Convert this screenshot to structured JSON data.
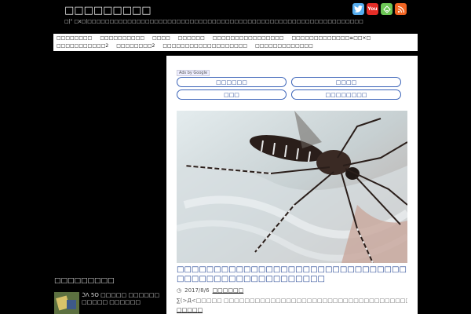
{
  "header": {
    "site_title": "□□□□□□□□□",
    "site_description": "□|\" □x□|□□□□□□□□□□□□□□□□□□□□□□□□□□□□□□□□□□□□□□□□□□□□□□□□□□□□□□□□□□□□□□",
    "social": [
      {
        "name": "twitter",
        "glyph": "t",
        "color": "#55acee"
      },
      {
        "name": "youtube",
        "glyph": "You",
        "color": "#e52d27"
      },
      {
        "name": "feedly",
        "glyph": "f",
        "color": "#6cc655"
      },
      {
        "name": "rss",
        "glyph": "rss",
        "color": "#f26522"
      }
    ]
  },
  "nav": {
    "items": [
      "□□□□□□□□",
      "□□□□□□□□□□",
      "□□□□",
      "□□□□□□",
      "□□□□□□□□□□□□□□□□",
      "□□□□□□□□□□□□□≡□□×□",
      "□□□□□□□□□□□2",
      "□□□□□□□□2",
      "□□□□□□□□□□□□□□□□□□□",
      "□□□□□□□□□□□□□"
    ]
  },
  "ads": {
    "label": "Ads by Google",
    "links": [
      "□□□□□□",
      "□□□□",
      "□□□",
      "□□□□□□□□"
    ]
  },
  "post": {
    "title": "□□□□□□□□□□□□□□□□□□□□□□□□□□□□□□□□□□□□□□□□□□□□□□□□□□□",
    "date": "2017/8/6",
    "category": "□□□□□□",
    "excerpt": "∑(>Д<□□□□□ □□□□□□□□□□□□□□□□□□□□□□□□□□□□□□□□□□□□□□...",
    "read_more": "□□□□□",
    "clock_glyph": "◷"
  },
  "sidebar": {
    "heading": "□□□□□□□□□",
    "recent": [
      {
        "title": "ℑΛ 5O □□□□□ □□□□□□□□□□□ □□□□□□"
      }
    ]
  }
}
